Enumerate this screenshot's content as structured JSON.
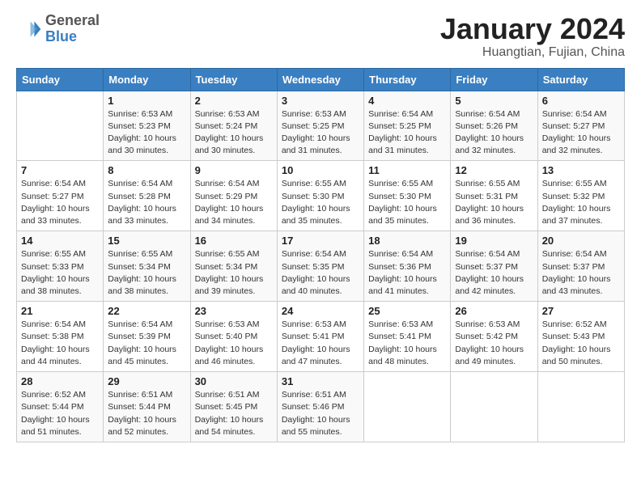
{
  "header": {
    "logo": {
      "general": "General",
      "blue": "Blue"
    },
    "title": "January 2024",
    "location": "Huangtian, Fujian, China"
  },
  "days_of_week": [
    "Sunday",
    "Monday",
    "Tuesday",
    "Wednesday",
    "Thursday",
    "Friday",
    "Saturday"
  ],
  "weeks": [
    [
      {
        "day": "",
        "info": ""
      },
      {
        "day": "1",
        "info": "Sunrise: 6:53 AM\nSunset: 5:23 PM\nDaylight: 10 hours\nand 30 minutes."
      },
      {
        "day": "2",
        "info": "Sunrise: 6:53 AM\nSunset: 5:24 PM\nDaylight: 10 hours\nand 30 minutes."
      },
      {
        "day": "3",
        "info": "Sunrise: 6:53 AM\nSunset: 5:25 PM\nDaylight: 10 hours\nand 31 minutes."
      },
      {
        "day": "4",
        "info": "Sunrise: 6:54 AM\nSunset: 5:25 PM\nDaylight: 10 hours\nand 31 minutes."
      },
      {
        "day": "5",
        "info": "Sunrise: 6:54 AM\nSunset: 5:26 PM\nDaylight: 10 hours\nand 32 minutes."
      },
      {
        "day": "6",
        "info": "Sunrise: 6:54 AM\nSunset: 5:27 PM\nDaylight: 10 hours\nand 32 minutes."
      }
    ],
    [
      {
        "day": "7",
        "info": "Sunrise: 6:54 AM\nSunset: 5:27 PM\nDaylight: 10 hours\nand 33 minutes."
      },
      {
        "day": "8",
        "info": "Sunrise: 6:54 AM\nSunset: 5:28 PM\nDaylight: 10 hours\nand 33 minutes."
      },
      {
        "day": "9",
        "info": "Sunrise: 6:54 AM\nSunset: 5:29 PM\nDaylight: 10 hours\nand 34 minutes."
      },
      {
        "day": "10",
        "info": "Sunrise: 6:55 AM\nSunset: 5:30 PM\nDaylight: 10 hours\nand 35 minutes."
      },
      {
        "day": "11",
        "info": "Sunrise: 6:55 AM\nSunset: 5:30 PM\nDaylight: 10 hours\nand 35 minutes."
      },
      {
        "day": "12",
        "info": "Sunrise: 6:55 AM\nSunset: 5:31 PM\nDaylight: 10 hours\nand 36 minutes."
      },
      {
        "day": "13",
        "info": "Sunrise: 6:55 AM\nSunset: 5:32 PM\nDaylight: 10 hours\nand 37 minutes."
      }
    ],
    [
      {
        "day": "14",
        "info": "Sunrise: 6:55 AM\nSunset: 5:33 PM\nDaylight: 10 hours\nand 38 minutes."
      },
      {
        "day": "15",
        "info": "Sunrise: 6:55 AM\nSunset: 5:34 PM\nDaylight: 10 hours\nand 38 minutes."
      },
      {
        "day": "16",
        "info": "Sunrise: 6:55 AM\nSunset: 5:34 PM\nDaylight: 10 hours\nand 39 minutes."
      },
      {
        "day": "17",
        "info": "Sunrise: 6:54 AM\nSunset: 5:35 PM\nDaylight: 10 hours\nand 40 minutes."
      },
      {
        "day": "18",
        "info": "Sunrise: 6:54 AM\nSunset: 5:36 PM\nDaylight: 10 hours\nand 41 minutes."
      },
      {
        "day": "19",
        "info": "Sunrise: 6:54 AM\nSunset: 5:37 PM\nDaylight: 10 hours\nand 42 minutes."
      },
      {
        "day": "20",
        "info": "Sunrise: 6:54 AM\nSunset: 5:37 PM\nDaylight: 10 hours\nand 43 minutes."
      }
    ],
    [
      {
        "day": "21",
        "info": "Sunrise: 6:54 AM\nSunset: 5:38 PM\nDaylight: 10 hours\nand 44 minutes."
      },
      {
        "day": "22",
        "info": "Sunrise: 6:54 AM\nSunset: 5:39 PM\nDaylight: 10 hours\nand 45 minutes."
      },
      {
        "day": "23",
        "info": "Sunrise: 6:53 AM\nSunset: 5:40 PM\nDaylight: 10 hours\nand 46 minutes."
      },
      {
        "day": "24",
        "info": "Sunrise: 6:53 AM\nSunset: 5:41 PM\nDaylight: 10 hours\nand 47 minutes."
      },
      {
        "day": "25",
        "info": "Sunrise: 6:53 AM\nSunset: 5:41 PM\nDaylight: 10 hours\nand 48 minutes."
      },
      {
        "day": "26",
        "info": "Sunrise: 6:53 AM\nSunset: 5:42 PM\nDaylight: 10 hours\nand 49 minutes."
      },
      {
        "day": "27",
        "info": "Sunrise: 6:52 AM\nSunset: 5:43 PM\nDaylight: 10 hours\nand 50 minutes."
      }
    ],
    [
      {
        "day": "28",
        "info": "Sunrise: 6:52 AM\nSunset: 5:44 PM\nDaylight: 10 hours\nand 51 minutes."
      },
      {
        "day": "29",
        "info": "Sunrise: 6:51 AM\nSunset: 5:44 PM\nDaylight: 10 hours\nand 52 minutes."
      },
      {
        "day": "30",
        "info": "Sunrise: 6:51 AM\nSunset: 5:45 PM\nDaylight: 10 hours\nand 54 minutes."
      },
      {
        "day": "31",
        "info": "Sunrise: 6:51 AM\nSunset: 5:46 PM\nDaylight: 10 hours\nand 55 minutes."
      },
      {
        "day": "",
        "info": ""
      },
      {
        "day": "",
        "info": ""
      },
      {
        "day": "",
        "info": ""
      }
    ]
  ]
}
